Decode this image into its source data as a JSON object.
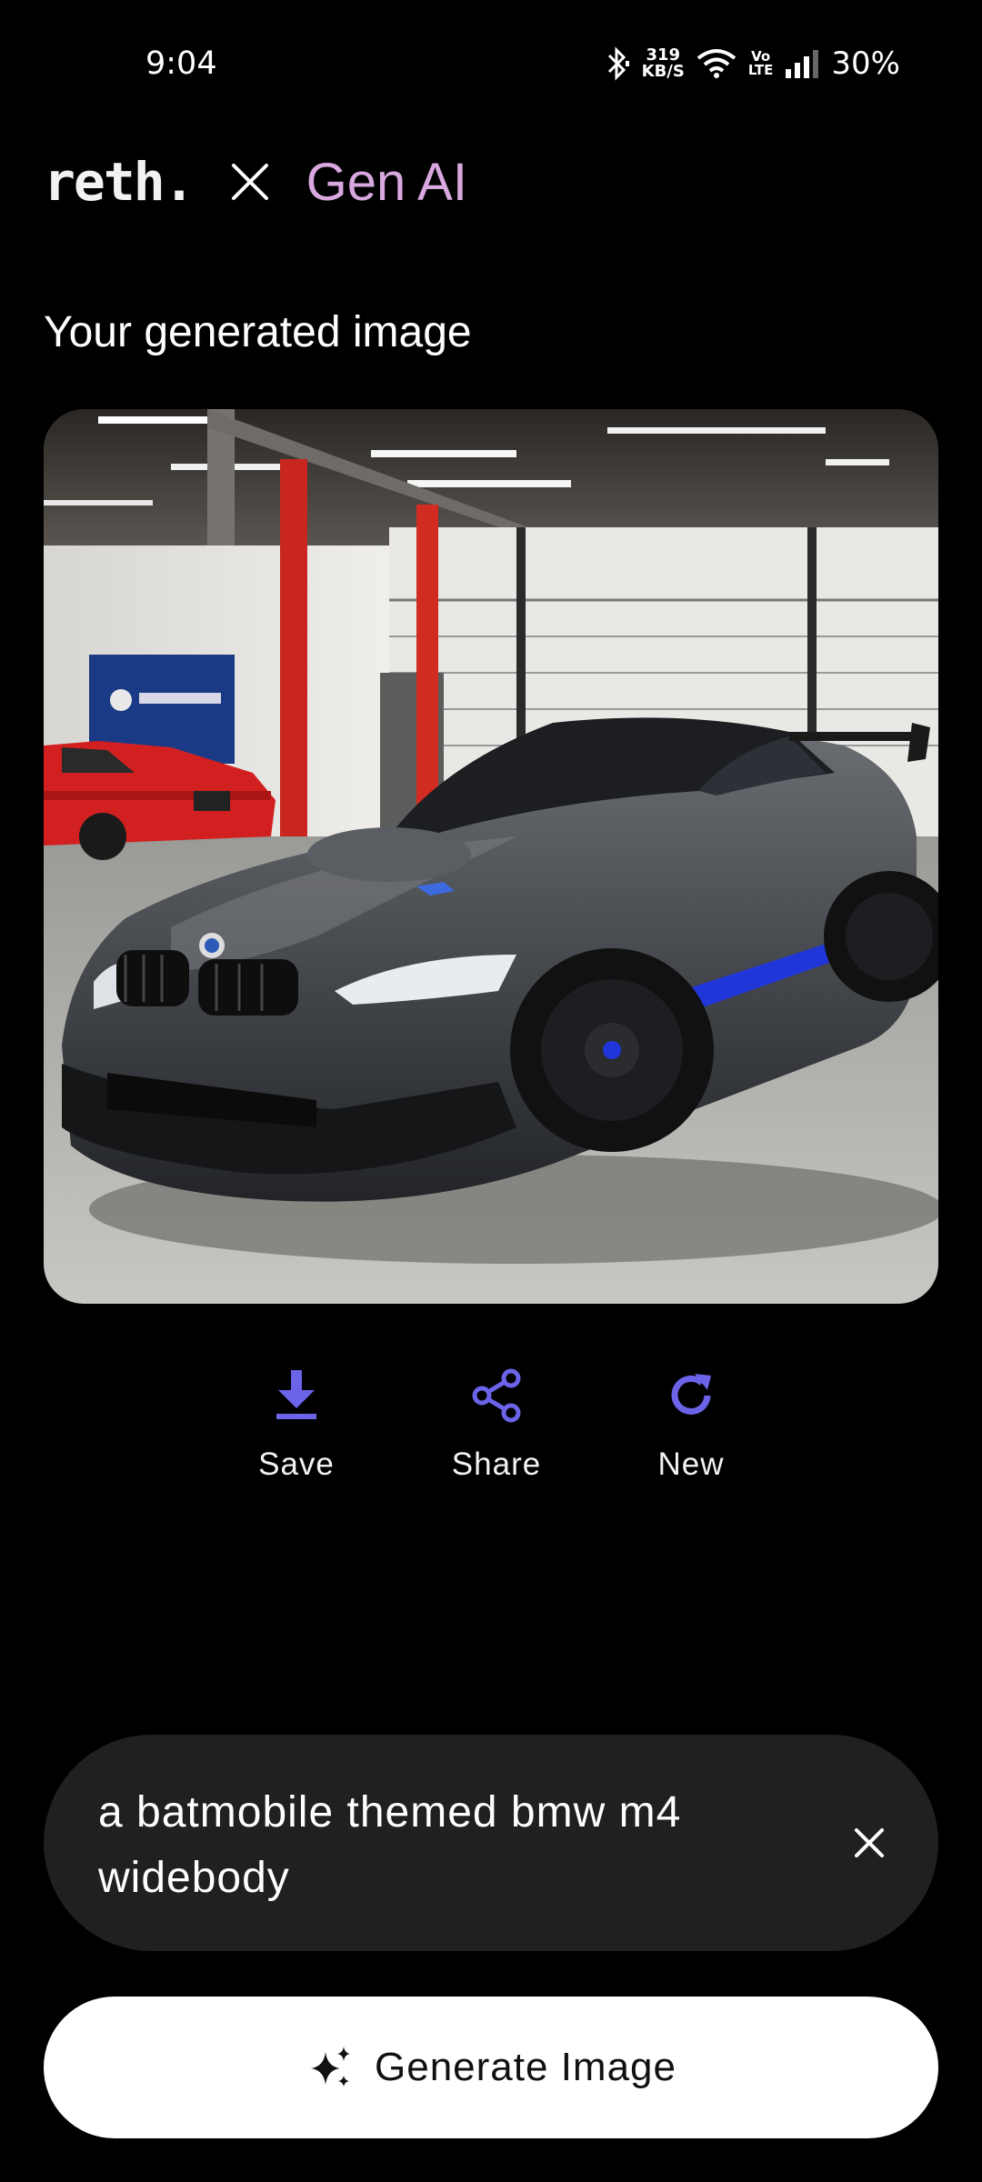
{
  "status_bar": {
    "time": "9:04",
    "net_speed_value": "319",
    "net_speed_unit": "KB/S",
    "volte_top": "Vo",
    "volte_bottom": "LTE",
    "battery": "30%",
    "icons": [
      "bluetooth-icon",
      "wifi-icon",
      "signal-icon"
    ]
  },
  "header": {
    "logo_text": "reth.",
    "separator_icon": "close-x-icon",
    "partner": "Gen AI"
  },
  "section_title": "Your generated image",
  "generated_image": {
    "description_icon": "generated-car-image"
  },
  "actions": [
    {
      "label": "Save",
      "icon": "download-icon"
    },
    {
      "label": "Share",
      "icon": "share-icon"
    },
    {
      "label": "New",
      "icon": "refresh-icon"
    }
  ],
  "prompt": {
    "text": "a batmobile themed bmw m4 widebody",
    "clear_icon": "close-icon"
  },
  "generate_button": {
    "label": "Generate Image",
    "icon": "sparkles-icon"
  },
  "colors": {
    "background": "#000000",
    "accent": "#6b63e8",
    "partner_text": "#d9a8e0",
    "prompt_bg": "#202020",
    "button_bg": "#ffffff"
  }
}
